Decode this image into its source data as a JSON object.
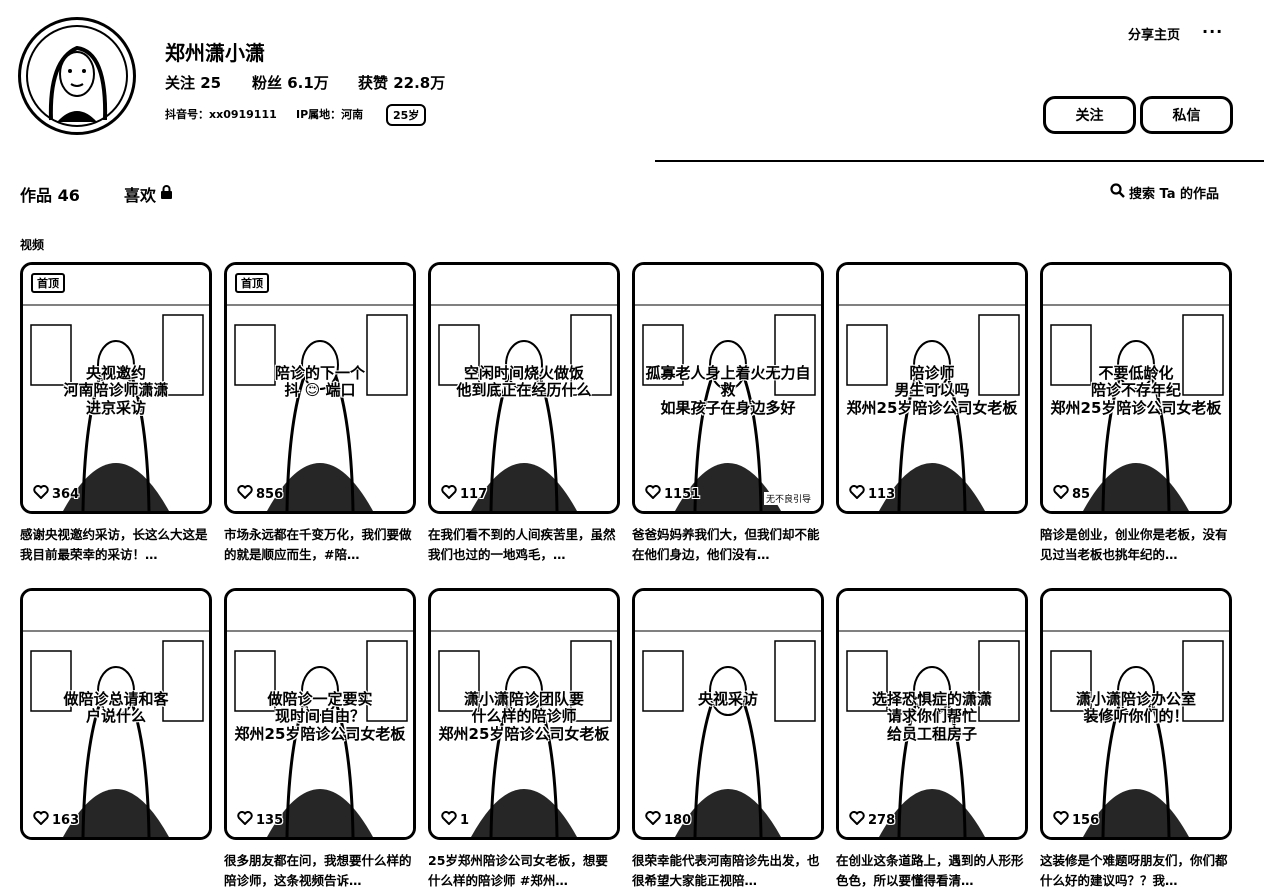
{
  "profile": {
    "name": "郑州潇小潇",
    "following": "关注 25",
    "followers": "粉丝 6.1万",
    "likes_received": "获赞 22.8万",
    "douyin_id": "抖音号：xx0919111",
    "ip_location": "IP属地：河南",
    "age": "25岁"
  },
  "header": {
    "share": "分享主页",
    "more": "···"
  },
  "actions": {
    "follow": "关注",
    "message": "私信"
  },
  "tabs": {
    "works": "作品 46",
    "liked": "喜欢"
  },
  "search": {
    "label": "搜索 Ta 的作品"
  },
  "section_label": "视频",
  "videos": [
    {
      "pinned": "首顶",
      "overlay": "央视邀约\n河南陪诊师潇潇\n进京采访",
      "likes": "364",
      "caption": "感谢央视邀约采访，长这么大这是我目前最荣幸的采访！…",
      "tag": ""
    },
    {
      "pinned": "首顶",
      "overlay": "陪诊的下一个\n抖 ☺ 端口",
      "likes": "856",
      "caption": "市场永远都在千变万化，我们要做的就是顺应而生，#陪…",
      "tag": ""
    },
    {
      "pinned": "",
      "overlay": "空闲时间烧火做饭\n他到底正在经历什么",
      "likes": "117",
      "caption": "在我们看不到的人间疾苦里，虽然我们也过的一地鸡毛，…",
      "tag": ""
    },
    {
      "pinned": "",
      "overlay": "孤寡老人身上着火无力自救\n如果孩子在身边多好",
      "likes": "1151",
      "caption": "爸爸妈妈养我们大，但我们却不能在他们身边，他们没有…",
      "tag": "无不良引导"
    },
    {
      "pinned": "",
      "overlay": "陪诊师\n男生可以吗\n郑州25岁陪诊公司女老板",
      "likes": "113",
      "caption": "",
      "tag": ""
    },
    {
      "pinned": "",
      "overlay": "不要低龄化\n陪诊不存年纪\n郑州25岁陪诊公司女老板",
      "likes": "85",
      "caption": "陪诊是创业，创业你是老板，没有见过当老板也挑年纪的…",
      "tag": ""
    },
    {
      "pinned": "",
      "overlay": "做陪诊总请和客\n户说什么",
      "likes": "163",
      "caption": "",
      "tag": ""
    },
    {
      "pinned": "",
      "overlay": "做陪诊一定要实\n现时间自由？\n郑州25岁陪诊公司女老板",
      "likes": "135",
      "caption": "很多朋友都在问，我想要什么样的陪诊师，这条视频告诉…",
      "tag": ""
    },
    {
      "pinned": "",
      "overlay": "潇小潇陪诊团队要\n什么样的陪诊师\n郑州25岁陪诊公司女老板",
      "likes": "1",
      "caption": "25岁郑州陪诊公司女老板，想要什么样的陪诊师 #郑州…",
      "tag": ""
    },
    {
      "pinned": "",
      "overlay": "央视采访",
      "likes": "180",
      "caption": "很荣幸能代表河南陪诊先出发，也很希望大家能正视陪…",
      "tag": ""
    },
    {
      "pinned": "",
      "overlay": "选择恐惧症的潇潇\n请求你们帮忙\n给员工租房子",
      "likes": "278",
      "caption": "在创业这条道路上，遇到的人形形色色，所以要懂得看清…",
      "tag": ""
    },
    {
      "pinned": "",
      "overlay": "潇小潇陪诊办公室\n装修听你们的！",
      "likes": "156",
      "caption": "这装修是个难题呀朋友们，你们都什么好的建议吗？？我…",
      "tag": ""
    }
  ]
}
